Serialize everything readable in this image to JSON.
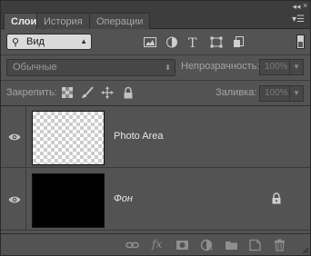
{
  "window": {
    "collapse_glyph": "◂◂",
    "close_glyph": "×"
  },
  "tabs": [
    {
      "label": "Слои",
      "active": true
    },
    {
      "label": "История",
      "active": false
    },
    {
      "label": "Операции",
      "active": false
    }
  ],
  "panel_menu_icon": "panel-menu-icon",
  "filter": {
    "kind_label": "Вид",
    "icons": [
      "pixel-filter-icon",
      "adjustment-filter-icon",
      "type-filter-icon",
      "shape-filter-icon",
      "smart-object-filter-icon"
    ],
    "toggle_icon": "filter-toggle-icon"
  },
  "blend": {
    "mode": "Обычные",
    "opacity_label": "Непрозрачность:",
    "opacity_value": "100%",
    "fill_label": "Заливка:",
    "fill_value": "100%"
  },
  "lock": {
    "label": "Закрепить:",
    "icons": [
      "lock-transparent-pixels-icon",
      "lock-image-pixels-icon",
      "lock-position-icon",
      "lock-all-icon"
    ]
  },
  "layers": [
    {
      "name": "Photo Area",
      "visible": true,
      "thumbnail": "transparent",
      "locked": false,
      "italic": false
    },
    {
      "name": "Фон",
      "visible": true,
      "thumbnail": "black",
      "locked": true,
      "italic": true
    }
  ],
  "bottom_bar": {
    "icons": [
      "link-layers-icon",
      "fx-icon",
      "add-mask-icon",
      "new-adjustment-layer-icon",
      "new-group-icon",
      "new-layer-icon",
      "delete-layer-icon"
    ],
    "fx_text": "fx"
  },
  "colors": {
    "panel_bg": "#535353",
    "tab_bar_bg": "#3d3d3d",
    "active_tab_text": "#ececec"
  }
}
